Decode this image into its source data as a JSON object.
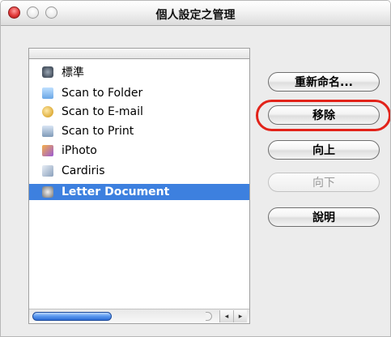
{
  "window": {
    "title": "個人設定之管理"
  },
  "profiles": {
    "items": [
      {
        "label": "標準",
        "icon": "standard-profile-icon"
      },
      {
        "label": "Scan to Folder",
        "icon": "folder-icon"
      },
      {
        "label": "Scan to E-mail",
        "icon": "email-icon"
      },
      {
        "label": "Scan to Print",
        "icon": "printer-icon"
      },
      {
        "label": "iPhoto",
        "icon": "iphoto-icon"
      },
      {
        "label": "Cardiris",
        "icon": "cardiris-icon"
      },
      {
        "label": "Letter Document",
        "icon": "letter-document-icon",
        "selected": true
      }
    ]
  },
  "buttons": {
    "rename": "重新命名...",
    "remove": "移除",
    "up": "向上",
    "down": "向下",
    "help": "說明"
  },
  "scrollbar": {
    "left_arrow": "◂",
    "right_arrow": "▸"
  },
  "colors": {
    "selection": "#3d80df",
    "highlight_ring": "#e2231a"
  }
}
